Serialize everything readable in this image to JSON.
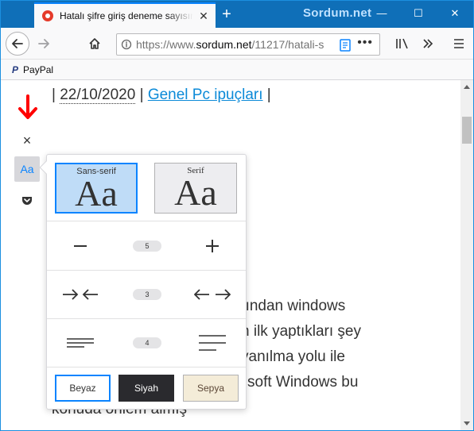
{
  "window": {
    "tab_title": "Hatalı şifre giriş deneme sayısını",
    "brand": "Sordum.net",
    "new_tab_symbol": "+",
    "minimize_symbol": "—",
    "maximize_symbol": "☐",
    "close_symbol": "✕",
    "tab_close_symbol": "✕"
  },
  "navbar": {
    "url_prefix": "https://www.",
    "url_host": "sordum.net",
    "url_path": "/11217/hatali-s",
    "page_actions": "•••"
  },
  "bookmarks": [
    {
      "label": "PayPal",
      "icon": "P"
    }
  ],
  "article": {
    "meta_sep_left": "|",
    "date": "22/10/2020",
    "meta_sep_mid": "|",
    "category": "Genel Pc ipuçları",
    "meta_sep_right": "|",
    "lines": [
      "bından windows",
      "n ilk yaptıkları şey",
      "yanılma yolu ile",
      "soft Windows bu",
      "konuda önlem almış"
    ]
  },
  "reader_tools": {
    "close_symbol": "×",
    "type_controls_label": "Aa"
  },
  "popup": {
    "fonts": [
      {
        "label": "Sans-serif",
        "sample": "Aa",
        "selected": true
      },
      {
        "label": "Serif",
        "sample": "Aa",
        "selected": false
      }
    ],
    "font_size": {
      "value": "5"
    },
    "content_width": {
      "value": "3"
    },
    "line_height": {
      "value": "4"
    },
    "themes": [
      {
        "label": "Beyaz",
        "selected": true
      },
      {
        "label": "Siyah",
        "selected": false
      },
      {
        "label": "Sepya",
        "selected": false
      }
    ]
  },
  "colors": {
    "titlebar": "#0f6fb8",
    "accent": "#0a84ff",
    "link": "#0b8ad8",
    "annotation_arrow": "#ff0000"
  }
}
